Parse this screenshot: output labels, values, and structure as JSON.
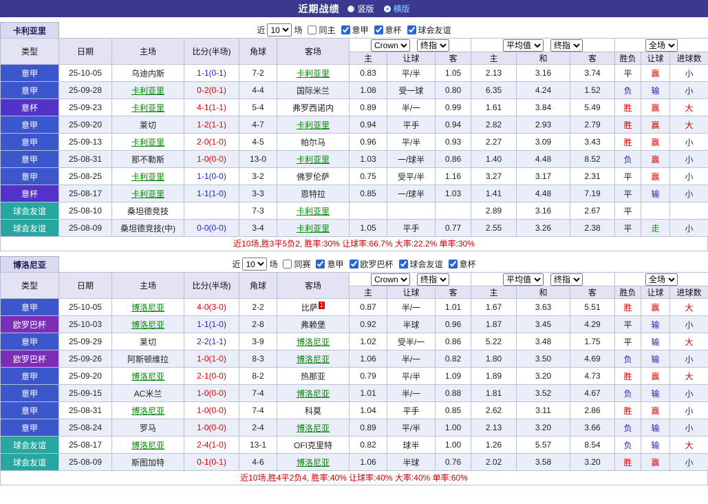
{
  "top_bar": {
    "title": "近期战绩",
    "radios": [
      {
        "label": "竖版",
        "selected": false
      },
      {
        "label": "横版",
        "selected": true
      }
    ]
  },
  "colors": {
    "type_bg": {
      "意甲": "#3c56cc",
      "意杯": "#5232c8",
      "欧罗巴杯": "#7c2eb8",
      "球会友谊": "#28a7a1"
    },
    "text": {
      "red": "#e00000",
      "blue": "#1f1fd0",
      "green": "#089b08",
      "black": "#222222"
    },
    "subject_team": "#008800"
  },
  "table_header": {
    "type": "类型",
    "date": "日期",
    "home": "主场",
    "score": "比分(半场)",
    "corner": "角球",
    "away": "客场",
    "asian": [
      "主",
      "让球",
      "客"
    ],
    "euro": [
      "主",
      "和",
      "客"
    ],
    "result": [
      "胜负",
      "让球",
      "进球数"
    ]
  },
  "sections": [
    {
      "team": "卡利亚里",
      "filter": {
        "near": "近",
        "count": "10",
        "unit": "场",
        "toggle": "同主",
        "competitions": [
          "意甲",
          "意杯",
          "球会友谊"
        ]
      },
      "selects": {
        "company": "Crown",
        "asian_final": "终指",
        "euro_avg": "平均值",
        "euro_final": "终指",
        "scope": "全场"
      },
      "summary": "近10场,胜3平5负2, 胜率:30% 让球率:66.7% 大率:22.2% 单率:30%",
      "rows": [
        {
          "type": "意甲",
          "date": "25-10-05",
          "home": "乌迪内斯",
          "home_subject": false,
          "score": "1-1(0-1)",
          "score_color": "blue",
          "corner": "7-2",
          "away": "卡利亚里",
          "away_subject": true,
          "asian_home": "0.83",
          "asian_line": "平/半",
          "asian_away": "1.05",
          "euro_home": "2.13",
          "euro_draw": "3.16",
          "euro_away": "3.74",
          "wdl": "平",
          "wdl_color": "black",
          "handicap": "赢",
          "handicap_color": "red",
          "goals": "小",
          "goals_color": "blue"
        },
        {
          "type": "意甲",
          "date": "25-09-28",
          "home": "卡利亚里",
          "home_subject": true,
          "score": "0-2(0-1)",
          "score_color": "red",
          "corner": "4-4",
          "away": "国际米兰",
          "away_subject": false,
          "asian_home": "1.08",
          "asian_line": "受一球",
          "asian_away": "0.80",
          "euro_home": "6.35",
          "euro_draw": "4.24",
          "euro_away": "1.52",
          "wdl": "负",
          "wdl_color": "blue",
          "handicap": "输",
          "handicap_color": "blue",
          "goals": "小",
          "goals_color": "blue"
        },
        {
          "type": "意杯",
          "date": "25-09-23",
          "home": "卡利亚里",
          "home_subject": true,
          "score": "4-1(1-1)",
          "score_color": "red",
          "corner": "5-4",
          "away": "弗罗西诺内",
          "away_subject": false,
          "asian_home": "0.89",
          "asian_line": "半/一",
          "asian_away": "0.99",
          "euro_home": "1.61",
          "euro_draw": "3.84",
          "euro_away": "5.49",
          "wdl": "胜",
          "wdl_color": "red",
          "handicap": "赢",
          "handicap_color": "red",
          "goals": "大",
          "goals_color": "red"
        },
        {
          "type": "意甲",
          "date": "25-09-20",
          "home": "莱切",
          "home_subject": false,
          "score": "1-2(1-1)",
          "score_color": "red",
          "corner": "4-7",
          "away": "卡利亚里",
          "away_subject": true,
          "asian_home": "0.94",
          "asian_line": "平手",
          "asian_away": "0.94",
          "euro_home": "2.82",
          "euro_draw": "2.93",
          "euro_away": "2.79",
          "wdl": "胜",
          "wdl_color": "red",
          "handicap": "赢",
          "handicap_color": "red",
          "goals": "大",
          "goals_color": "red"
        },
        {
          "type": "意甲",
          "date": "25-09-13",
          "home": "卡利亚里",
          "home_subject": true,
          "score": "2-0(1-0)",
          "score_color": "red",
          "corner": "4-5",
          "away": "帕尔马",
          "away_subject": false,
          "asian_home": "0.96",
          "asian_line": "平/半",
          "asian_away": "0.93",
          "euro_home": "2.27",
          "euro_draw": "3.09",
          "euro_away": "3.43",
          "wdl": "胜",
          "wdl_color": "red",
          "handicap": "赢",
          "handicap_color": "red",
          "goals": "小",
          "goals_color": "blue"
        },
        {
          "type": "意甲",
          "date": "25-08-31",
          "home": "那不勒斯",
          "home_subject": false,
          "score": "1-0(0-0)",
          "score_color": "red",
          "corner": "13-0",
          "away": "卡利亚里",
          "away_subject": true,
          "asian_home": "1.03",
          "asian_line": "一/球半",
          "asian_away": "0.86",
          "euro_home": "1.40",
          "euro_draw": "4.48",
          "euro_away": "8.52",
          "wdl": "负",
          "wdl_color": "blue",
          "handicap": "赢",
          "handicap_color": "red",
          "goals": "小",
          "goals_color": "blue"
        },
        {
          "type": "意甲",
          "date": "25-08-25",
          "home": "卡利亚里",
          "home_subject": true,
          "score": "1-1(0-0)",
          "score_color": "blue",
          "corner": "3-2",
          "away": "佛罗伦萨",
          "away_subject": false,
          "asian_home": "0.75",
          "asian_line": "受平/半",
          "asian_away": "1.16",
          "euro_home": "3.27",
          "euro_draw": "3.17",
          "euro_away": "2.31",
          "wdl": "平",
          "wdl_color": "black",
          "handicap": "赢",
          "handicap_color": "red",
          "goals": "小",
          "goals_color": "blue"
        },
        {
          "type": "意杯",
          "date": "25-08-17",
          "home": "卡利亚里",
          "home_subject": true,
          "score": "1-1(1-0)",
          "score_color": "blue",
          "corner": "3-3",
          "away": "恩特拉",
          "away_subject": false,
          "asian_home": "0.85",
          "asian_line": "一/球半",
          "asian_away": "1.03",
          "euro_home": "1.41",
          "euro_draw": "4.48",
          "euro_away": "7.19",
          "wdl": "平",
          "wdl_color": "black",
          "handicap": "输",
          "handicap_color": "blue",
          "goals": "小",
          "goals_color": "blue"
        },
        {
          "type": "球会友谊",
          "date": "25-08-10",
          "home": "桑坦德竞技",
          "home_subject": false,
          "score": "",
          "score_color": "black",
          "corner": "7-3",
          "away": "卡利亚里",
          "away_subject": true,
          "asian_home": "",
          "asian_line": "",
          "asian_away": "",
          "euro_home": "2.89",
          "euro_draw": "3.16",
          "euro_away": "2.67",
          "wdl": "平",
          "wdl_color": "black",
          "handicap": "",
          "handicap_color": "black",
          "goals": "",
          "goals_color": "black"
        },
        {
          "type": "球会友谊",
          "date": "25-08-09",
          "home": "桑坦德竞技(中)",
          "home_subject": false,
          "score": "0-0(0-0)",
          "score_color": "blue",
          "corner": "3-4",
          "away": "卡利亚里",
          "away_subject": true,
          "asian_home": "1.05",
          "asian_line": "平手",
          "asian_away": "0.77",
          "euro_home": "2.55",
          "euro_draw": "3.26",
          "euro_away": "2.38",
          "wdl": "平",
          "wdl_color": "black",
          "handicap": "走",
          "handicap_color": "green",
          "goals": "小",
          "goals_color": "blue"
        }
      ]
    },
    {
      "team": "博洛尼亚",
      "filter": {
        "near": "近",
        "count": "10",
        "unit": "场",
        "toggle": "同赛",
        "competitions": [
          "意甲",
          "欧罗巴杯",
          "球会友谊",
          "意杯"
        ]
      },
      "selects": {
        "company": "Crown",
        "asian_final": "终指",
        "euro_avg": "平均值",
        "euro_final": "终指",
        "scope": "全场"
      },
      "summary": "近10场,胜4平2负4, 胜率:40% 让球率:40% 大率:40% 单率:60%",
      "rows": [
        {
          "type": "意甲",
          "date": "25-10-05",
          "home": "博洛尼亚",
          "home_subject": true,
          "score": "4-0(3-0)",
          "score_color": "red",
          "corner": "2-2",
          "away": "比萨",
          "away_subject": false,
          "away_badge": "1",
          "asian_home": "0.87",
          "asian_line": "半/一",
          "asian_away": "1.01",
          "euro_home": "1.67",
          "euro_draw": "3.63",
          "euro_away": "5.51",
          "wdl": "胜",
          "wdl_color": "red",
          "handicap": "赢",
          "handicap_color": "red",
          "goals": "大",
          "goals_color": "red"
        },
        {
          "type": "欧罗巴杯",
          "date": "25-10-03",
          "home": "博洛尼亚",
          "home_subject": true,
          "score": "1-1(1-0)",
          "score_color": "blue",
          "corner": "2-8",
          "away": "弗赖堡",
          "away_subject": false,
          "asian_home": "0.92",
          "asian_line": "半球",
          "asian_away": "0.96",
          "euro_home": "1.87",
          "euro_draw": "3.45",
          "euro_away": "4.29",
          "wdl": "平",
          "wdl_color": "black",
          "handicap": "输",
          "handicap_color": "blue",
          "goals": "小",
          "goals_color": "blue"
        },
        {
          "type": "意甲",
          "date": "25-09-29",
          "home": "莱切",
          "home_subject": false,
          "score": "2-2(1-1)",
          "score_color": "blue",
          "corner": "3-9",
          "away": "博洛尼亚",
          "away_subject": true,
          "asian_home": "1.02",
          "asian_line": "受半/一",
          "asian_away": "0.86",
          "euro_home": "5.22",
          "euro_draw": "3.48",
          "euro_away": "1.75",
          "wdl": "平",
          "wdl_color": "black",
          "handicap": "输",
          "handicap_color": "blue",
          "goals": "大",
          "goals_color": "red"
        },
        {
          "type": "欧罗巴杯",
          "date": "25-09-26",
          "home": "阿斯顿维拉",
          "home_subject": false,
          "score": "1-0(1-0)",
          "score_color": "red",
          "corner": "8-3",
          "away": "博洛尼亚",
          "away_subject": true,
          "asian_home": "1.06",
          "asian_line": "半/一",
          "asian_away": "0.82",
          "euro_home": "1.80",
          "euro_draw": "3.50",
          "euro_away": "4.69",
          "wdl": "负",
          "wdl_color": "blue",
          "handicap": "输",
          "handicap_color": "blue",
          "goals": "小",
          "goals_color": "blue"
        },
        {
          "type": "意甲",
          "date": "25-09-20",
          "home": "博洛尼亚",
          "home_subject": true,
          "score": "2-1(0-0)",
          "score_color": "red",
          "corner": "8-2",
          "away": "热那亚",
          "away_subject": false,
          "asian_home": "0.79",
          "asian_line": "平/半",
          "asian_away": "1.09",
          "euro_home": "1.89",
          "euro_draw": "3.20",
          "euro_away": "4.73",
          "wdl": "胜",
          "wdl_color": "red",
          "handicap": "赢",
          "handicap_color": "red",
          "goals": "大",
          "goals_color": "red"
        },
        {
          "type": "意甲",
          "date": "25-09-15",
          "home": "AC米兰",
          "home_subject": false,
          "score": "1-0(0-0)",
          "score_color": "red",
          "corner": "7-4",
          "away": "博洛尼亚",
          "away_subject": true,
          "asian_home": "1.01",
          "asian_line": "半/一",
          "asian_away": "0.88",
          "euro_home": "1.81",
          "euro_draw": "3.52",
          "euro_away": "4.67",
          "wdl": "负",
          "wdl_color": "blue",
          "handicap": "输",
          "handicap_color": "blue",
          "goals": "小",
          "goals_color": "blue"
        },
        {
          "type": "意甲",
          "date": "25-08-31",
          "home": "博洛尼亚",
          "home_subject": true,
          "score": "1-0(0-0)",
          "score_color": "red",
          "corner": "7-4",
          "away": "科莫",
          "away_subject": false,
          "asian_home": "1.04",
          "asian_line": "平手",
          "asian_away": "0.85",
          "euro_home": "2.62",
          "euro_draw": "3.11",
          "euro_away": "2.86",
          "wdl": "胜",
          "wdl_color": "red",
          "handicap": "赢",
          "handicap_color": "red",
          "goals": "小",
          "goals_color": "blue"
        },
        {
          "type": "意甲",
          "date": "25-08-24",
          "home": "罗马",
          "home_subject": false,
          "score": "1-0(0-0)",
          "score_color": "red",
          "corner": "2-4",
          "away": "博洛尼亚",
          "away_subject": true,
          "asian_home": "0.89",
          "asian_line": "平/半",
          "asian_away": "1.00",
          "euro_home": "2.13",
          "euro_draw": "3.20",
          "euro_away": "3.66",
          "wdl": "负",
          "wdl_color": "blue",
          "handicap": "输",
          "handicap_color": "blue",
          "goals": "小",
          "goals_color": "blue"
        },
        {
          "type": "球会友谊",
          "date": "25-08-17",
          "home": "博洛尼亚",
          "home_subject": true,
          "score": "2-4(1-0)",
          "score_color": "red",
          "corner": "13-1",
          "away": "OFI克里特",
          "away_subject": false,
          "asian_home": "0.82",
          "asian_line": "球半",
          "asian_away": "1.00",
          "euro_home": "1.26",
          "euro_draw": "5.57",
          "euro_away": "8.54",
          "wdl": "负",
          "wdl_color": "blue",
          "handicap": "输",
          "handicap_color": "blue",
          "goals": "大",
          "goals_color": "red"
        },
        {
          "type": "球会友谊",
          "date": "25-08-09",
          "home": "斯图加特",
          "home_subject": false,
          "score": "0-1(0-1)",
          "score_color": "red",
          "corner": "4-6",
          "away": "博洛尼亚",
          "away_subject": true,
          "asian_home": "1.06",
          "asian_line": "半球",
          "asian_away": "0.76",
          "euro_home": "2.02",
          "euro_draw": "3.58",
          "euro_away": "3.20",
          "wdl": "胜",
          "wdl_color": "red",
          "handicap": "赢",
          "handicap_color": "red",
          "goals": "小",
          "goals_color": "blue"
        }
      ]
    }
  ]
}
